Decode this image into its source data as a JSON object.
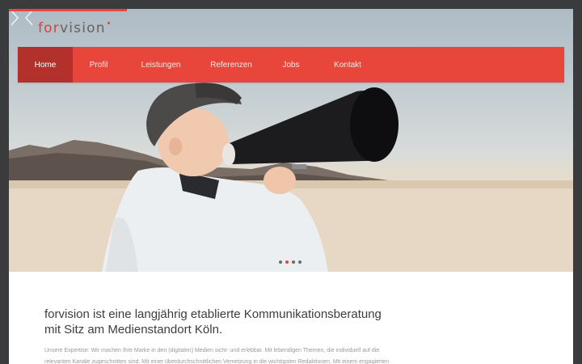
{
  "brand": {
    "logo_prefix": "for",
    "logo_suffix": "vision"
  },
  "colors": {
    "accent": "#e8453b",
    "nav_active": "#b2322b",
    "page_bg": "#3a3b3d"
  },
  "nav": {
    "items": [
      {
        "label": "Home",
        "active": true
      },
      {
        "label": "Profil"
      },
      {
        "label": "Leistungen"
      },
      {
        "label": "Referenzen"
      },
      {
        "label": "Jobs"
      },
      {
        "label": "Kontakt"
      }
    ]
  },
  "slider": {
    "total": 4,
    "active_index": 1,
    "prev_icon": "chevron-left-icon",
    "next_icon": "chevron-right-icon"
  },
  "intro": {
    "headline_line1": "forvision ist eine langjährig etablierte Kommunikationsberatung",
    "headline_line2": "mit Sitz am Medienstandort Köln.",
    "body_line1": "Unsere Expertise: Wir machen Ihre Marke in den (digitalen) Medien sicht- und erlebbar. Mit lebendigen Themen, die individuell auf die",
    "body_line2": "relevanten Kanäle zugeschnitten sind. Mit einer überdurchschnittlichen Vernetzung in die wichtigsten Redaktionen. Mit einem engagierten"
  }
}
